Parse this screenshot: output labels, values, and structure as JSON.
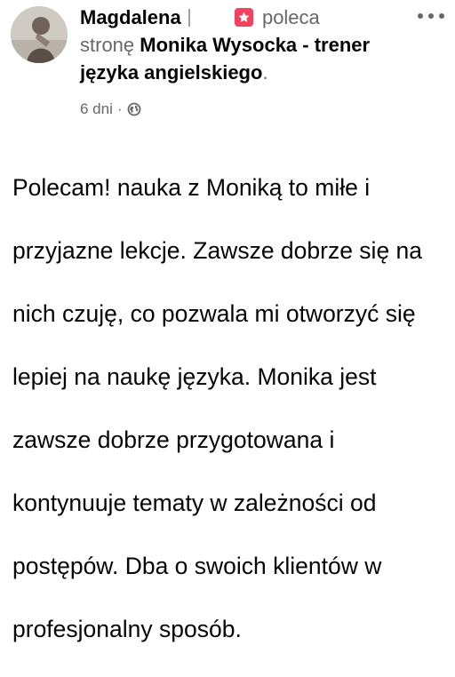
{
  "post": {
    "author_name": "Magdalena",
    "recommend_text": "poleca",
    "recommend_prefix": "stronę",
    "page_name": "Monika Wysocka - trener języka angielskiego",
    "page_suffix": ".",
    "time_ago": "6 dni",
    "separator": "·",
    "privacy_icon": "globe-icon",
    "more_icon": "more-options-icon",
    "recommend_icon": "recommendation-star-icon",
    "body_lines": [
      "Polecam! nauka z Moniką to miłe i",
      "przyjazne lekcje. Zawsze dobrze się na",
      "nich czuję, co pozwala mi otworzyć się",
      "lepiej na naukę języka. Monika jest",
      "zawsze dobrze przygotowana i",
      "kontynuuje tematy w zależności od",
      "postępów. Dba o swoich klientów w",
      "profesjonalny sposób."
    ]
  },
  "colors": {
    "text_primary": "#050505",
    "text_secondary": "#65676b",
    "recommend_red": "#f3425f",
    "background": "#ffffff"
  }
}
